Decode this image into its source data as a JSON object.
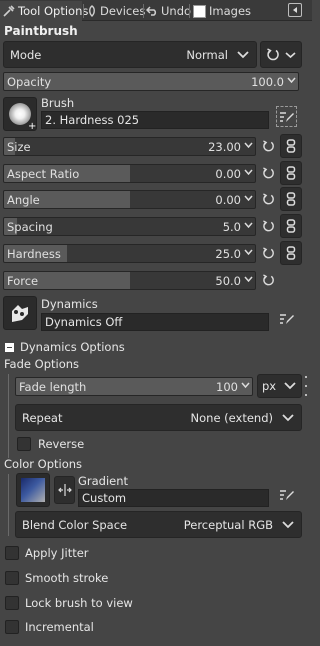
{
  "tabs": [
    {
      "label": "Tool Options",
      "icon": "tool-options-icon"
    },
    {
      "label": "Devices",
      "icon": "devices-icon"
    },
    {
      "label": "Undo",
      "icon": "undo-icon"
    },
    {
      "label": "Images",
      "icon": "images-icon"
    }
  ],
  "tool_title": "Paintbrush",
  "mode": {
    "label": "Mode",
    "value": "Normal"
  },
  "opacity": {
    "label": "Opacity",
    "value": "100.0",
    "level": 1.0
  },
  "brush": {
    "label": "Brush",
    "value": "2. Hardness 025"
  },
  "sliders": [
    {
      "label": "Size",
      "value": "23.00",
      "level": 0.045
    },
    {
      "label": "Aspect Ratio",
      "value": "0.00",
      "level": 0.5
    },
    {
      "label": "Angle",
      "value": "0.00",
      "level": 0.5
    },
    {
      "label": "Spacing",
      "value": "5.0",
      "level": 0.05
    },
    {
      "label": "Hardness",
      "value": "25.0",
      "level": 0.25
    },
    {
      "label": "Force",
      "value": "50.0",
      "level": 0.5
    }
  ],
  "dynamics": {
    "label": "Dynamics",
    "value": "Dynamics Off"
  },
  "dynamics_options": {
    "label": "Dynamics Options"
  },
  "fade": {
    "section": "Fade Options",
    "length_label": "Fade length",
    "length_value": "100",
    "unit": "px",
    "repeat_label": "Repeat",
    "repeat_value": "None (extend)",
    "reverse": "Reverse"
  },
  "color": {
    "section": "Color Options",
    "gradient_label": "Gradient",
    "gradient_value": "Custom",
    "blend_label": "Blend Color Space",
    "blend_value": "Perceptual RGB"
  },
  "checks": [
    {
      "label": "Apply Jitter",
      "checked": false
    },
    {
      "label": "Smooth stroke",
      "checked": false
    },
    {
      "label": "Lock brush to view",
      "checked": false
    },
    {
      "label": "Incremental",
      "checked": false
    }
  ]
}
